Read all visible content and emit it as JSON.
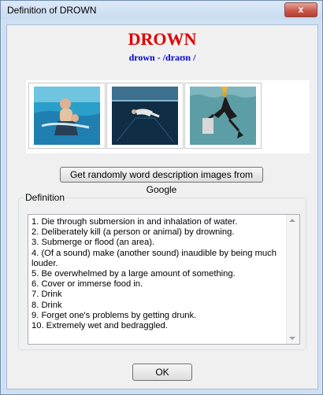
{
  "window": {
    "title": "Definition of DROWN",
    "close_glyph": "x"
  },
  "header": {
    "word": "DROWN",
    "pronunciation": "drown - /draʊn /"
  },
  "images": [
    {
      "icon": "swimming-pool-photo"
    },
    {
      "icon": "underwater-photo"
    },
    {
      "icon": "drowning-illustration"
    }
  ],
  "google_button": {
    "label": "Get randomly word description images from Google"
  },
  "definition": {
    "label": "Definition",
    "items": [
      "1. Die through submersion in and inhalation of water.",
      "2. Deliberately kill (a person or animal) by drowning.",
      "3. Submerge or flood (an area).",
      "4. (Of a sound) make (another sound) inaudible by being much louder.",
      "5. Be overwhelmed by a large amount of something.",
      "6. Cover or immerse food in.",
      "7. Drink",
      "8. Drink",
      "9. Forget one's problems by getting drunk.",
      "10. Extremely wet and bedraggled."
    ]
  },
  "ok_button": {
    "label": "OK"
  }
}
